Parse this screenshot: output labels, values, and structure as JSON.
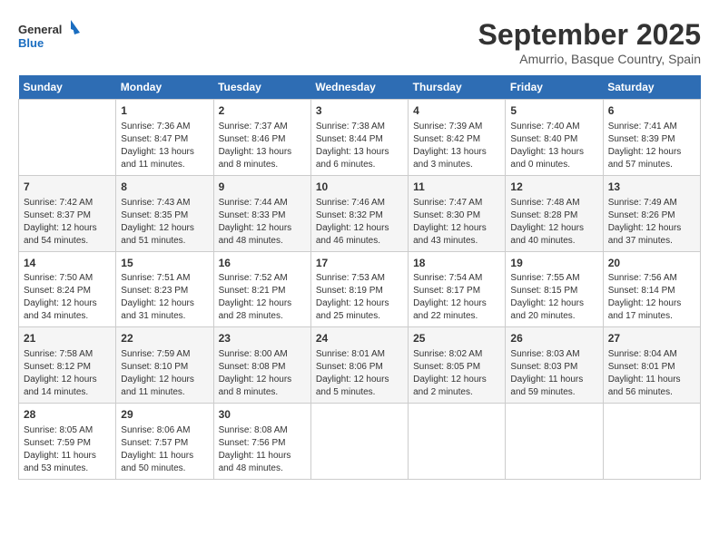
{
  "header": {
    "logo_general": "General",
    "logo_blue": "Blue",
    "month": "September 2025",
    "location": "Amurrio, Basque Country, Spain"
  },
  "days_of_week": [
    "Sunday",
    "Monday",
    "Tuesday",
    "Wednesday",
    "Thursday",
    "Friday",
    "Saturday"
  ],
  "weeks": [
    [
      {
        "day": "",
        "info": ""
      },
      {
        "day": "1",
        "info": "Sunrise: 7:36 AM\nSunset: 8:47 PM\nDaylight: 13 hours\nand 11 minutes."
      },
      {
        "day": "2",
        "info": "Sunrise: 7:37 AM\nSunset: 8:46 PM\nDaylight: 13 hours\nand 8 minutes."
      },
      {
        "day": "3",
        "info": "Sunrise: 7:38 AM\nSunset: 8:44 PM\nDaylight: 13 hours\nand 6 minutes."
      },
      {
        "day": "4",
        "info": "Sunrise: 7:39 AM\nSunset: 8:42 PM\nDaylight: 13 hours\nand 3 minutes."
      },
      {
        "day": "5",
        "info": "Sunrise: 7:40 AM\nSunset: 8:40 PM\nDaylight: 13 hours\nand 0 minutes."
      },
      {
        "day": "6",
        "info": "Sunrise: 7:41 AM\nSunset: 8:39 PM\nDaylight: 12 hours\nand 57 minutes."
      }
    ],
    [
      {
        "day": "7",
        "info": "Sunrise: 7:42 AM\nSunset: 8:37 PM\nDaylight: 12 hours\nand 54 minutes."
      },
      {
        "day": "8",
        "info": "Sunrise: 7:43 AM\nSunset: 8:35 PM\nDaylight: 12 hours\nand 51 minutes."
      },
      {
        "day": "9",
        "info": "Sunrise: 7:44 AM\nSunset: 8:33 PM\nDaylight: 12 hours\nand 48 minutes."
      },
      {
        "day": "10",
        "info": "Sunrise: 7:46 AM\nSunset: 8:32 PM\nDaylight: 12 hours\nand 46 minutes."
      },
      {
        "day": "11",
        "info": "Sunrise: 7:47 AM\nSunset: 8:30 PM\nDaylight: 12 hours\nand 43 minutes."
      },
      {
        "day": "12",
        "info": "Sunrise: 7:48 AM\nSunset: 8:28 PM\nDaylight: 12 hours\nand 40 minutes."
      },
      {
        "day": "13",
        "info": "Sunrise: 7:49 AM\nSunset: 8:26 PM\nDaylight: 12 hours\nand 37 minutes."
      }
    ],
    [
      {
        "day": "14",
        "info": "Sunrise: 7:50 AM\nSunset: 8:24 PM\nDaylight: 12 hours\nand 34 minutes."
      },
      {
        "day": "15",
        "info": "Sunrise: 7:51 AM\nSunset: 8:23 PM\nDaylight: 12 hours\nand 31 minutes."
      },
      {
        "day": "16",
        "info": "Sunrise: 7:52 AM\nSunset: 8:21 PM\nDaylight: 12 hours\nand 28 minutes."
      },
      {
        "day": "17",
        "info": "Sunrise: 7:53 AM\nSunset: 8:19 PM\nDaylight: 12 hours\nand 25 minutes."
      },
      {
        "day": "18",
        "info": "Sunrise: 7:54 AM\nSunset: 8:17 PM\nDaylight: 12 hours\nand 22 minutes."
      },
      {
        "day": "19",
        "info": "Sunrise: 7:55 AM\nSunset: 8:15 PM\nDaylight: 12 hours\nand 20 minutes."
      },
      {
        "day": "20",
        "info": "Sunrise: 7:56 AM\nSunset: 8:14 PM\nDaylight: 12 hours\nand 17 minutes."
      }
    ],
    [
      {
        "day": "21",
        "info": "Sunrise: 7:58 AM\nSunset: 8:12 PM\nDaylight: 12 hours\nand 14 minutes."
      },
      {
        "day": "22",
        "info": "Sunrise: 7:59 AM\nSunset: 8:10 PM\nDaylight: 12 hours\nand 11 minutes."
      },
      {
        "day": "23",
        "info": "Sunrise: 8:00 AM\nSunset: 8:08 PM\nDaylight: 12 hours\nand 8 minutes."
      },
      {
        "day": "24",
        "info": "Sunrise: 8:01 AM\nSunset: 8:06 PM\nDaylight: 12 hours\nand 5 minutes."
      },
      {
        "day": "25",
        "info": "Sunrise: 8:02 AM\nSunset: 8:05 PM\nDaylight: 12 hours\nand 2 minutes."
      },
      {
        "day": "26",
        "info": "Sunrise: 8:03 AM\nSunset: 8:03 PM\nDaylight: 11 hours\nand 59 minutes."
      },
      {
        "day": "27",
        "info": "Sunrise: 8:04 AM\nSunset: 8:01 PM\nDaylight: 11 hours\nand 56 minutes."
      }
    ],
    [
      {
        "day": "28",
        "info": "Sunrise: 8:05 AM\nSunset: 7:59 PM\nDaylight: 11 hours\nand 53 minutes."
      },
      {
        "day": "29",
        "info": "Sunrise: 8:06 AM\nSunset: 7:57 PM\nDaylight: 11 hours\nand 50 minutes."
      },
      {
        "day": "30",
        "info": "Sunrise: 8:08 AM\nSunset: 7:56 PM\nDaylight: 11 hours\nand 48 minutes."
      },
      {
        "day": "",
        "info": ""
      },
      {
        "day": "",
        "info": ""
      },
      {
        "day": "",
        "info": ""
      },
      {
        "day": "",
        "info": ""
      }
    ]
  ]
}
